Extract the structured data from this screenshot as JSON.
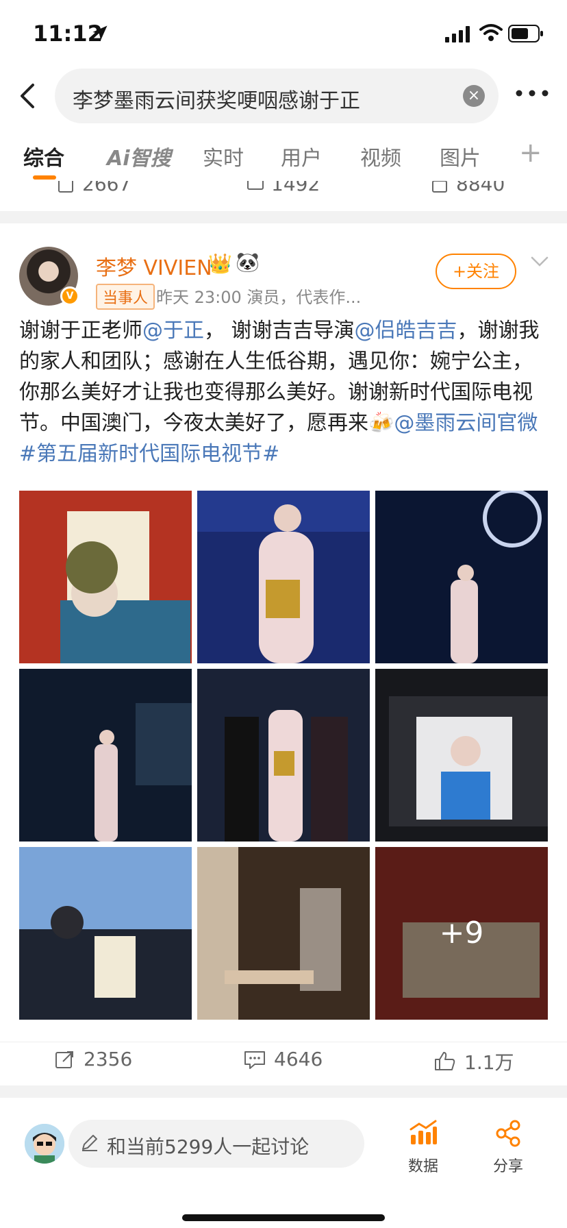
{
  "status": {
    "time": "11:12"
  },
  "search": {
    "query": "李梦墨雨云间获奖哽咽感谢于正"
  },
  "tabs": [
    {
      "label": "综合",
      "active": true
    },
    {
      "label": "Ai智搜"
    },
    {
      "label": "实时"
    },
    {
      "label": "用户"
    },
    {
      "label": "视频"
    },
    {
      "label": "图片"
    }
  ],
  "prev_post": {
    "reposts": "2667",
    "comments": "1492",
    "likes": "8840"
  },
  "post": {
    "author": "李梦 VIVIEN",
    "role_badge": "当事人",
    "meta": "昨天 23:00  演员，代表作...",
    "follow_label": "+关注",
    "text_parts": {
      "p1": "谢谢于正老师",
      "m1": "@于正",
      "p2": "， 谢谢吉吉导演",
      "m2": "@侣皓吉吉",
      "p3": "，谢谢我的家人和团队；感谢在人生低谷期，遇见你：婉宁公主， 你那么美好才让我也变得那么美好。谢谢新时代国际电视节。中国澳门，今夜太美好了，愿再来🍻",
      "m3": "@墨雨云间官微",
      "tag": "#第五届新时代国际电视节#"
    },
    "image_more": "+9",
    "reposts": "2356",
    "comments": "4646",
    "likes": "1.1万"
  },
  "bottom": {
    "discuss_placeholder": "和当前5299人一起讨论",
    "data_label": "数据",
    "share_label": "分享"
  },
  "colors": {
    "accent": "#ff8200",
    "link": "#4a78b8"
  }
}
